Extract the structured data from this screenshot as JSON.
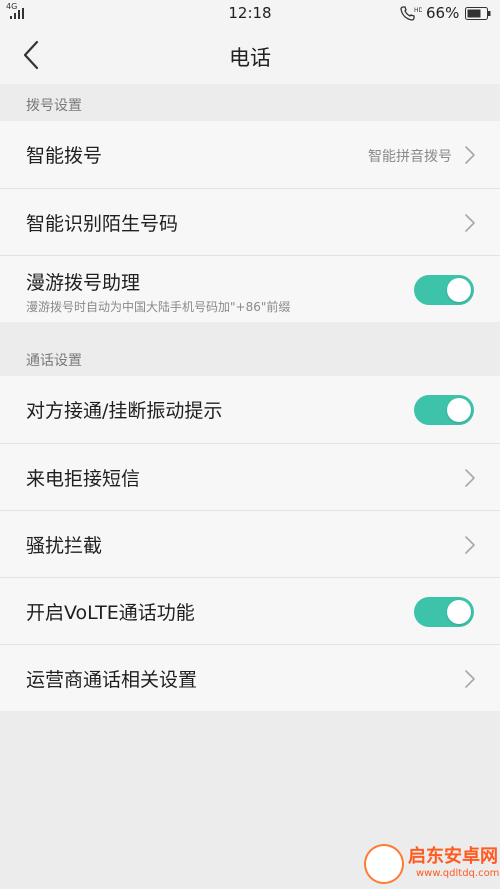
{
  "status_bar": {
    "network": "4G",
    "time": "12:18",
    "battery_percent": "66%"
  },
  "nav": {
    "title": "电话"
  },
  "sections": [
    {
      "header": "拨号设置",
      "rows": [
        {
          "label": "智能拨号",
          "value": "智能拼音拨号",
          "control": "chevron"
        },
        {
          "label": "智能识别陌生号码",
          "control": "chevron"
        },
        {
          "label": "漫游拨号助理",
          "sublabel": "漫游拨号时自动为中国大陆手机号码加\"+86\"前缀",
          "control": "toggle",
          "on": true
        }
      ]
    },
    {
      "header": "通话设置",
      "rows": [
        {
          "label": "对方接通/挂断振动提示",
          "control": "toggle",
          "on": true
        },
        {
          "label": "来电拒接短信",
          "control": "chevron"
        },
        {
          "label": "骚扰拦截",
          "control": "chevron"
        },
        {
          "label": "开启VoLTE通话功能",
          "control": "toggle",
          "on": true
        },
        {
          "label": "运营商通话相关设置",
          "control": "chevron"
        }
      ]
    }
  ],
  "watermark": {
    "text": "启东安卓网",
    "url": "www.qdltdq.com"
  },
  "colors": {
    "accent_toggle": "#3cc3aa",
    "background": "#ececec",
    "row_background": "#f7f7f7"
  }
}
